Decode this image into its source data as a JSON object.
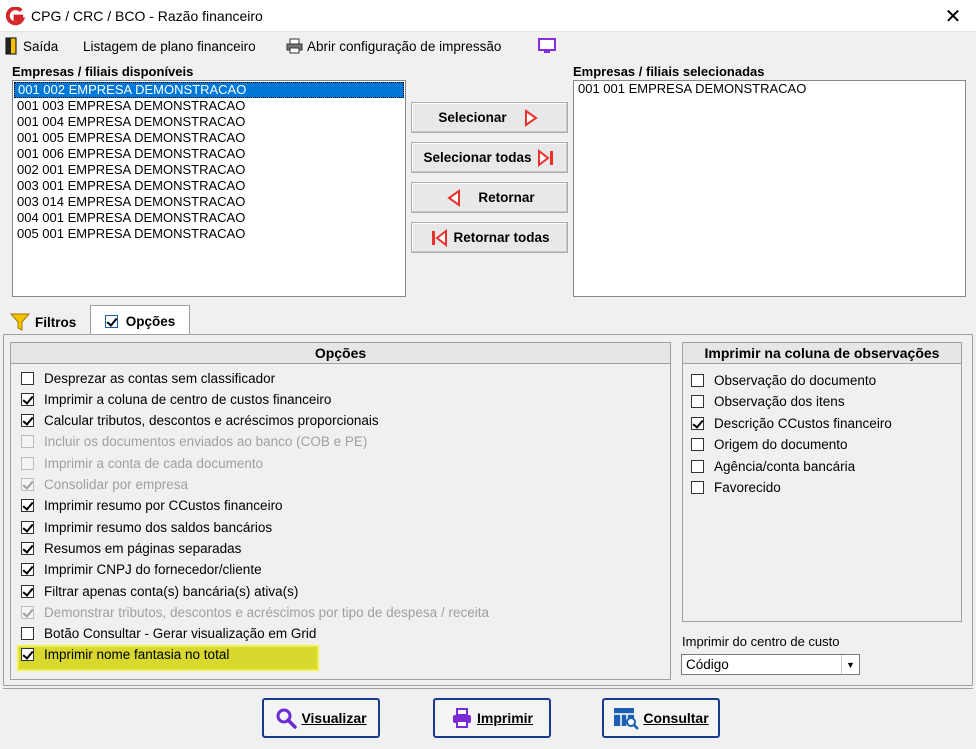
{
  "window": {
    "title": "CPG / CRC / BCO - Razão financeiro",
    "close": "✕"
  },
  "menu": {
    "exit": "Saída",
    "listing": "Listagem de plano financeiro",
    "print_config": "Abrir configuração de impressão"
  },
  "available": {
    "label": "Empresas / filiais disponíveis",
    "items": [
      "001 002 EMPRESA DEMONSTRACAO",
      "001 003 EMPRESA DEMONSTRACAO",
      "001 004 EMPRESA DEMONSTRACAO",
      "001 005 EMPRESA DEMONSTRACAO",
      "001 006 EMPRESA DEMONSTRACAO",
      "002 001 EMPRESA DEMONSTRACAO",
      "003 001 EMPRESA DEMONSTRACAO",
      "003 014 EMPRESA DEMONSTRACAO",
      "004 001 EMPRESA DEMONSTRACAO",
      "005 001 EMPRESA DEMONSTRACAO"
    ]
  },
  "selected": {
    "label": "Empresas / filiais selecionadas",
    "items": [
      "001 001 EMPRESA DEMONSTRACAO"
    ]
  },
  "transfer": {
    "select": "Selecionar",
    "select_all": "Selecionar todas",
    "return": "Retornar",
    "return_all": "Retornar todas"
  },
  "tabs": {
    "filters": "Filtros",
    "options": "Opções"
  },
  "options": {
    "header": "Opções",
    "items": [
      {
        "label": "Desprezar as contas sem classificador",
        "checked": false,
        "disabled": false
      },
      {
        "label": "Imprimir a coluna de centro de custos financeiro",
        "checked": true,
        "disabled": false
      },
      {
        "label": "Calcular tributos, descontos e acréscimos proporcionais",
        "checked": true,
        "disabled": false
      },
      {
        "label": "Incluir os documentos enviados ao banco (COB e PE)",
        "checked": false,
        "disabled": true
      },
      {
        "label": "Imprimir a conta de cada documento",
        "checked": false,
        "disabled": true
      },
      {
        "label": "Consolidar por empresa",
        "checked": true,
        "disabled": true
      },
      {
        "label": "Imprimir resumo por CCustos financeiro",
        "checked": true,
        "disabled": false
      },
      {
        "label": "Imprimir resumo dos saldos bancários",
        "checked": true,
        "disabled": false
      },
      {
        "label": "Resumos em páginas separadas",
        "checked": true,
        "disabled": false
      },
      {
        "label": "Imprimir CNPJ do fornecedor/cliente",
        "checked": true,
        "disabled": false
      },
      {
        "label": "Filtrar apenas conta(s) bancária(s) ativa(s)",
        "checked": true,
        "disabled": false
      },
      {
        "label": "Demonstrar tributos, descontos e acréscimos por tipo de despesa / receita",
        "checked": true,
        "disabled": true
      },
      {
        "label": "Botão Consultar - Gerar visualização em Grid",
        "checked": false,
        "disabled": false
      },
      {
        "label": "Imprimir nome fantasia no total",
        "checked": true,
        "disabled": false
      }
    ]
  },
  "observations": {
    "header": "Imprimir na coluna de observações",
    "items": [
      {
        "label": "Observação do documento",
        "checked": false
      },
      {
        "label": "Observação dos itens",
        "checked": false
      },
      {
        "label": "Descrição CCustos financeiro",
        "checked": true
      },
      {
        "label": "Origem do documento",
        "checked": false
      },
      {
        "label": "Agência/conta bancária",
        "checked": false
      },
      {
        "label": "Favorecido",
        "checked": false
      }
    ]
  },
  "cost_center": {
    "label": "Imprimir do centro de custo",
    "value": "Código"
  },
  "actions": {
    "view": "Visualizar",
    "print": "Imprimir",
    "consult": "Consultar"
  },
  "colors": {
    "accent": "#0078d7",
    "red_arrow": "#e8322c",
    "highlight": "#d6d619",
    "button_border": "#1a3a8f"
  }
}
